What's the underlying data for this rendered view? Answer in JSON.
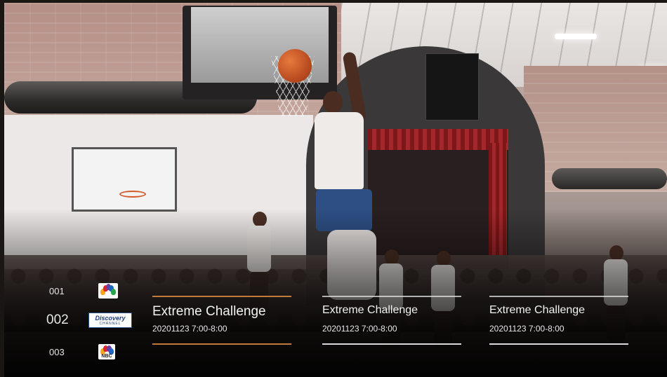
{
  "channels": [
    {
      "number": "001",
      "logo": "peacock-logo-icon"
    },
    {
      "number": "002",
      "logo": "discovery-logo-icon",
      "logo_text": "Discovery",
      "logo_subtext": "CHANNEL"
    },
    {
      "number": "003",
      "logo": "nbc-logo-icon",
      "logo_text": "NBC"
    }
  ],
  "programs": [
    {
      "title": "Extreme Challenge",
      "time": "20201123  7:00-8:00",
      "focused": true
    },
    {
      "title": "Extreme Challenge",
      "time": "20201123  7:00-8:00",
      "focused": false
    },
    {
      "title": "Extreme Challenge",
      "time": "20201123  7:00-8:00",
      "focused": false
    }
  ],
  "colors": {
    "focus_accent": "#c07a3a",
    "text": "#f2f2f2"
  }
}
